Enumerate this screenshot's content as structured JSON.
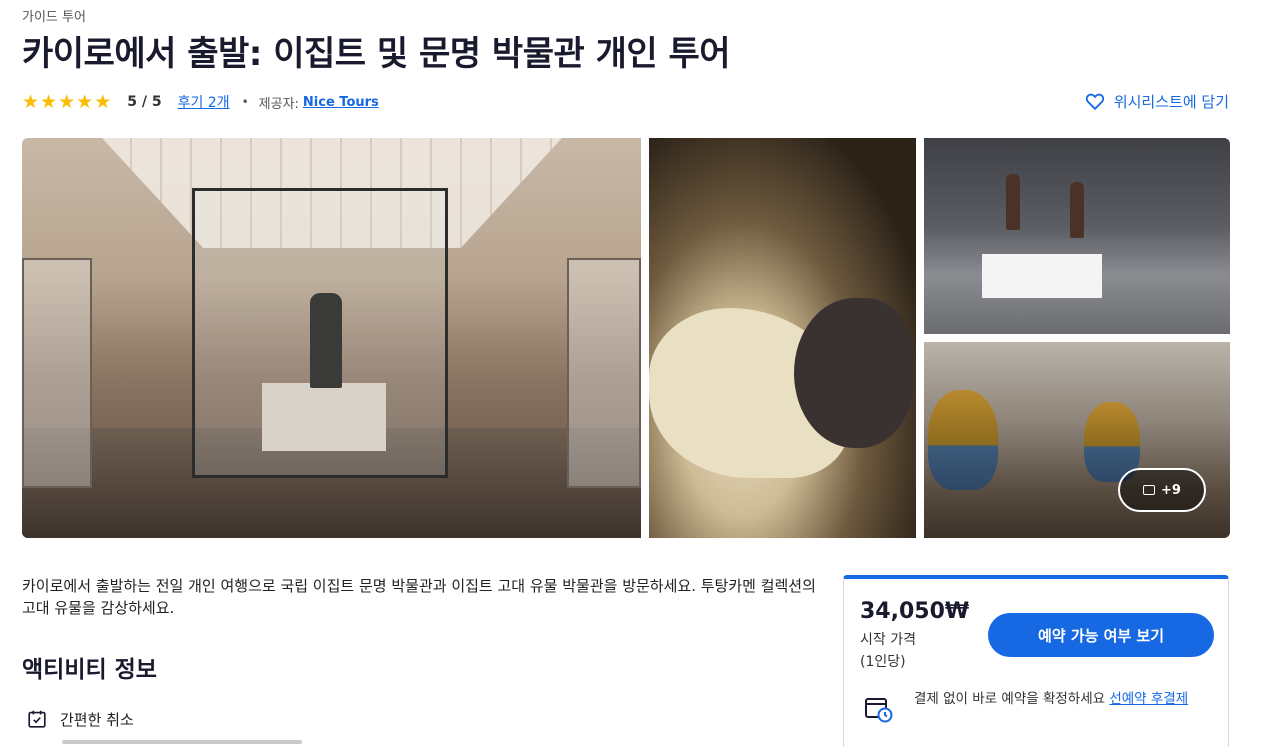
{
  "header": {
    "category": "가이드 투어",
    "title": "카이로에서 출발: 이집트 및 문명 박물관 개인 투어",
    "rating_stars": 5,
    "score": "5 / 5",
    "reviews_link": "후기 2개",
    "separator": "•",
    "provider_label": "제공자:",
    "provider_name": "Nice Tours",
    "wishlist_label": "위시리스트에 담기"
  },
  "gallery": {
    "more_count": "+9",
    "icons": {
      "more": "image-icon"
    }
  },
  "main": {
    "description": "카이로에서 출발하는 전일 개인 여행으로 국립 이집트 문명 박물관과 이집트 고대 유물 박물관을 방문하세요. 투탕카멘 컬렉션의 고대 유물을 감상하세요.",
    "section_title": "액티비티 정보",
    "features": [
      {
        "label": "간편한 취소",
        "icon": "calendar-check-icon"
      }
    ]
  },
  "booking": {
    "price": "34,050₩",
    "price_label": "시작 가격",
    "price_unit": "(1인당)",
    "button_label": "예약 가능 여부 보기",
    "reserve_text": "결제 없이 바로 예약을 확정하세요",
    "reserve_link": "선예약 후결제",
    "accent_color": "#1668e3"
  },
  "colors": {
    "link": "#1668e3",
    "star": "#fbbc04",
    "title": "#1a1a2e"
  }
}
